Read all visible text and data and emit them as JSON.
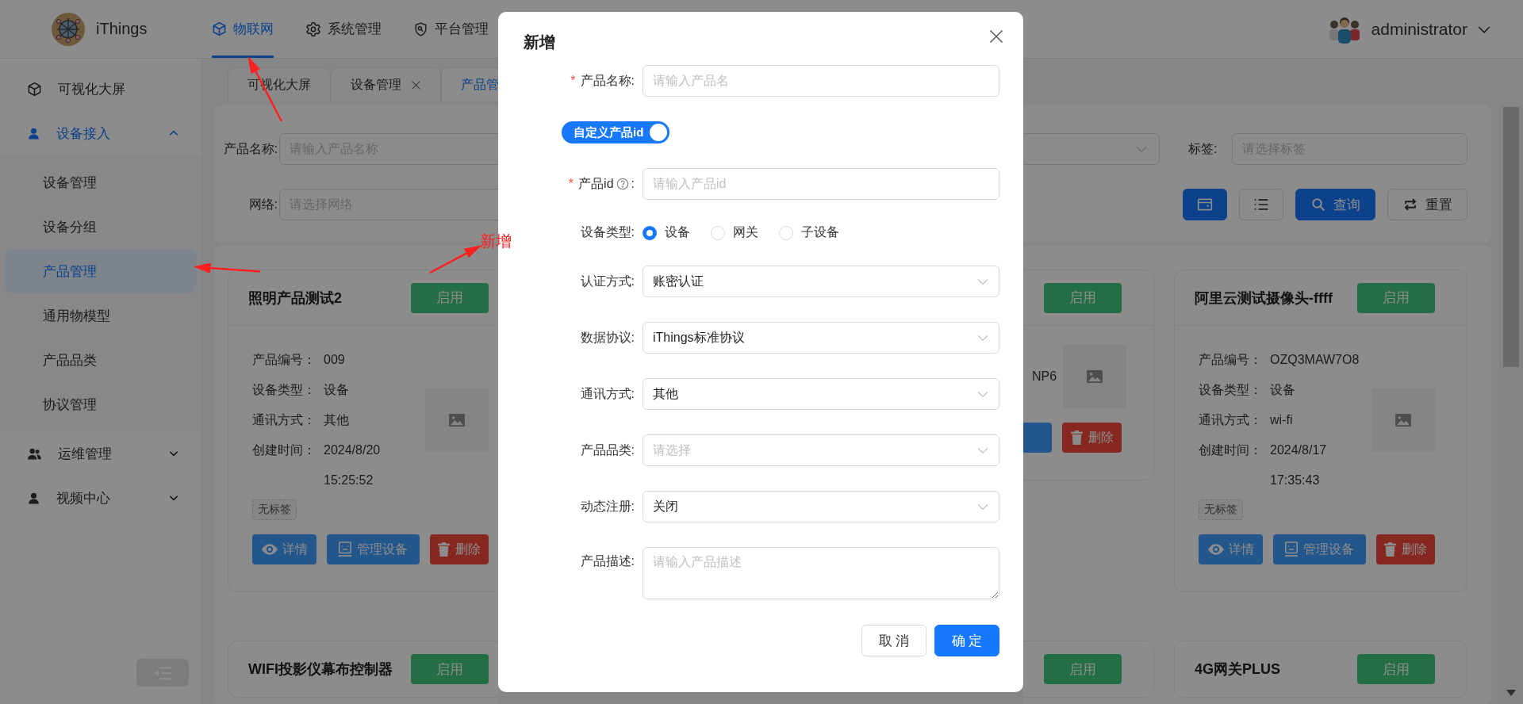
{
  "header": {
    "brand": "iThings",
    "nav": [
      {
        "label": "物联网",
        "selected": true
      },
      {
        "label": "系统管理",
        "selected": false
      },
      {
        "label": "平台管理",
        "selected": false
      }
    ],
    "user": {
      "name": "administrator"
    }
  },
  "sidebar": {
    "items": [
      {
        "label": "可视化大屏",
        "selected": false
      },
      {
        "label": "设备接入",
        "selected": false,
        "expanded": true,
        "children": [
          {
            "label": "设备管理",
            "selected": false
          },
          {
            "label": "设备分组",
            "selected": false
          },
          {
            "label": "产品管理",
            "selected": true
          },
          {
            "label": "通用物模型",
            "selected": false
          },
          {
            "label": "产品品类",
            "selected": false
          },
          {
            "label": "协议管理",
            "selected": false
          }
        ]
      },
      {
        "label": "运维管理",
        "selected": false,
        "expanded": false
      },
      {
        "label": "视频中心",
        "selected": false,
        "expanded": false
      }
    ]
  },
  "page_tabs": [
    {
      "label": "可视化大屏",
      "selected": false,
      "closable": false
    },
    {
      "label": "设备管理",
      "selected": false,
      "closable": true
    },
    {
      "label": "产品管",
      "selected": true,
      "closable": false
    }
  ],
  "filters": {
    "left": [
      {
        "label": "产品名称:",
        "placeholder": "请输入产品名称"
      },
      {
        "label": "网络:",
        "placeholder": "请选择网络"
      }
    ],
    "right": [
      {
        "kind": "select"
      },
      {
        "kind": "input",
        "label": "标签:",
        "placeholder": "请选择标签"
      }
    ],
    "actions": [
      {
        "kind": "card-view",
        "selected": true
      },
      {
        "kind": "list-view",
        "selected": false
      },
      {
        "kind": "search",
        "label": "查询"
      },
      {
        "kind": "reset",
        "label": "重置"
      }
    ]
  },
  "cards": {
    "column_1": [
      {
        "title": "照明产品测试2",
        "status": "启用",
        "fields": [
          {
            "label": "产品编号：",
            "value": "009"
          },
          {
            "label": "设备类型：",
            "value": "设备"
          },
          {
            "label": "通讯方式：",
            "value": "其他"
          },
          {
            "label": "创建时间：",
            "value": "2024/8/20 15:25:52"
          }
        ],
        "tag": "无标签",
        "actions": [
          {
            "kind": "detail",
            "label": "详情"
          },
          {
            "kind": "manage",
            "label": "管理设备"
          },
          {
            "kind": "delete",
            "label": "删除"
          }
        ]
      },
      {
        "title": "WIFI投影仪幕布控制器",
        "status": "启用"
      }
    ],
    "column_3": [
      {
        "status": "启用",
        "fields": [
          {
            "value": "NP6"
          }
        ],
        "actions": [
          {
            "kind": "manage"
          },
          {
            "kind": "delete",
            "label": "删除"
          }
        ]
      },
      {
        "status": "启用"
      }
    ],
    "column_4": [
      {
        "title": "阿里云测试摄像头-ffff",
        "status": "启用",
        "fields": [
          {
            "label": "产品编号：",
            "value": "OZQ3MAW7O8"
          },
          {
            "label": "设备类型：",
            "value": "设备"
          },
          {
            "label": "通讯方式：",
            "value": "wi-fi"
          },
          {
            "label": "创建时间：",
            "value": "2024/8/17 17:35:43"
          }
        ],
        "tag": "无标签",
        "actions": [
          {
            "kind": "detail",
            "label": "详情"
          },
          {
            "kind": "manage",
            "label": "管理设备"
          },
          {
            "kind": "delete",
            "label": "删除"
          }
        ]
      },
      {
        "title": "4G网关PLUS",
        "status": "启用"
      }
    ]
  },
  "modal": {
    "title": "新增",
    "fields": [
      {
        "kind": "input",
        "required_mark": "*",
        "label": "产品名称:",
        "placeholder": "请输入产品名"
      },
      {
        "kind": "switch",
        "label": "自定义产品id",
        "on": true
      },
      {
        "kind": "input",
        "required_mark": "*",
        "label": "产品id",
        "help": true,
        "colon": ":",
        "placeholder": "请输入产品id"
      },
      {
        "kind": "radio",
        "label": "设备类型:",
        "options": [
          {
            "label": "设备",
            "selected": true
          },
          {
            "label": "网关",
            "selected": false
          },
          {
            "label": "子设备",
            "selected": false
          }
        ]
      },
      {
        "kind": "select",
        "label": "认证方式:",
        "value": "账密认证"
      },
      {
        "kind": "select",
        "label": "数据协议:",
        "value": "iThings标准协议"
      },
      {
        "kind": "select",
        "label": "通讯方式:",
        "value": "其他"
      },
      {
        "kind": "select",
        "label": "产品品类:",
        "placeholder": "请选择"
      },
      {
        "kind": "select",
        "label": "动态注册:",
        "value": "关闭"
      },
      {
        "kind": "textarea",
        "label": "产品描述:",
        "placeholder": "请输入产品描述"
      }
    ],
    "buttons": [
      {
        "kind": "default",
        "label": "取 消"
      },
      {
        "kind": "primary",
        "label": "确 定"
      }
    ]
  },
  "annotation": {
    "label": "新增"
  }
}
